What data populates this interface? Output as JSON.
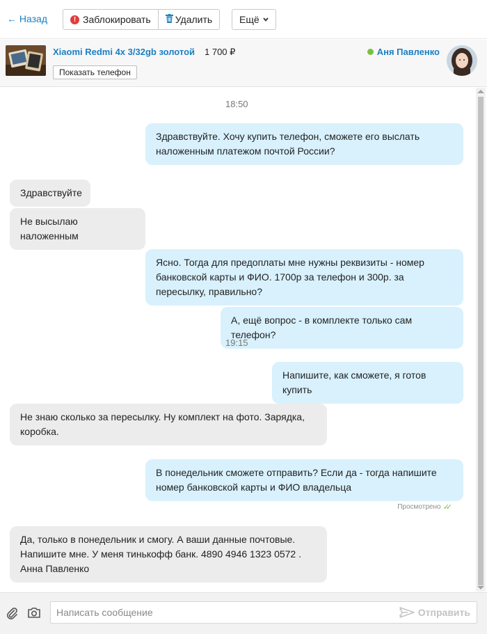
{
  "toolbar": {
    "back_label": "← Назад",
    "block_label": "Заблокировать",
    "delete_label": "Удалить",
    "more_label": "Ещё"
  },
  "item": {
    "title": "Xiaomi Redmi 4x 3/32gb золотой",
    "price": "1 700 ₽",
    "show_phone_label": "Показать телефон",
    "seller_name": "Аня Павленко"
  },
  "chat": {
    "messages": [
      {
        "time": "18:50"
      },
      {
        "direction": "out",
        "text": "Здравствуйте. Хочу купить телефон, сможете его выслать наложенным платежом почтой России?"
      },
      {
        "direction": "in",
        "text": "Здравствуйте"
      },
      {
        "direction": "in",
        "text": "Не высылаю наложенным"
      },
      {
        "direction": "out",
        "text": "Ясно. Тогда для предоплаты мне нужны реквизиты - номер банковской карты и ФИО. 1700р за телефон и 300р. за пересылку, правильно?"
      },
      {
        "direction": "out",
        "text": "А, ещё вопрос - в комплекте только сам телефон?"
      },
      {
        "time": "19:15"
      },
      {
        "direction": "out",
        "text": "Напишите, как сможете, я готов купить"
      },
      {
        "direction": "in",
        "text": "Не знаю сколько за пересылку. Ну комплект на фото. Зарядка, коробка."
      },
      {
        "direction": "out",
        "text": "В понедельник сможете отправить? Если да - тогда напишите номер банковской карты и ФИО владельца"
      },
      {
        "direction": "in",
        "text": "Да, только в понедельник и смогу. А ваши данные почтовые. Напишите мне. У меня тинькофф банк. 4890 4946 1323 0572 . Анна Павленко"
      }
    ],
    "seen_label": "Просмотрено"
  },
  "composer": {
    "placeholder": "Написать сообщение",
    "send_label": "Отправить"
  },
  "colors": {
    "link": "#1a7fc4",
    "outgoing_bubble": "#d8f1fd",
    "incoming_bubble": "#ececec",
    "online": "#7ac142",
    "block": "#e23b3b"
  }
}
